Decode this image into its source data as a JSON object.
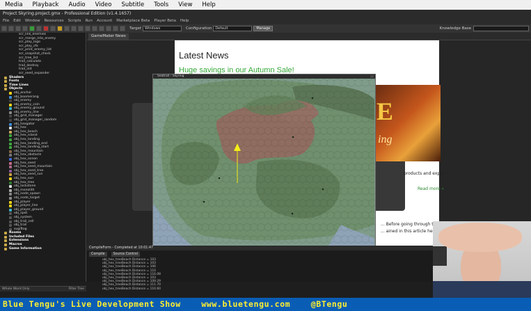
{
  "os_menu": [
    "Media",
    "Playback",
    "Audio",
    "Video",
    "Subtitle",
    "Tools",
    "View",
    "Help"
  ],
  "gm_title": "Project Skyring.project.gmx - Professional Edition (v1.4.1657)",
  "gm_menu": [
    "File",
    "Edit",
    "Window",
    "Resources",
    "Scripts",
    "Run",
    "Account",
    "Marketplace Beta",
    "Player Beta",
    "Help"
  ],
  "toolbar": {
    "target_label": "Target",
    "target_value": "Windows",
    "config_label": "Configuration",
    "config_value": "Default",
    "manage": "Manage",
    "knowledge": "Knowledge Base"
  },
  "tree": [
    {
      "t": "scr_link_enemies",
      "d": 3
    },
    {
      "t": "scr_merge_into_enemy",
      "d": 3
    },
    {
      "t": "scr_play_logo",
      "d": 3
    },
    {
      "t": "scr_play_sfx",
      "d": 3
    },
    {
      "t": "scr_print_enemy_list",
      "d": 3
    },
    {
      "t": "scr_snapshot_check",
      "d": 3
    },
    {
      "t": "scr_tree_list",
      "d": 3
    },
    {
      "t": "trail_calculate",
      "d": 3
    },
    {
      "t": "trail_destroy",
      "d": 3
    },
    {
      "t": "trail_init",
      "d": 3
    },
    {
      "t": "scr_seed_expander",
      "d": 3
    },
    {
      "t": "Shaders",
      "d": 1,
      "g": true
    },
    {
      "t": "Fonts",
      "d": 1,
      "g": true
    },
    {
      "t": "Time Lines",
      "d": 1,
      "g": true
    },
    {
      "t": "Objects",
      "d": 1,
      "g": true
    },
    {
      "t": "obj_anchor",
      "d": 2,
      "c": "#f2d21a"
    },
    {
      "t": "obj_boomerang",
      "d": 2,
      "c": "#3a8ad8"
    },
    {
      "t": "obj_enemy",
      "d": 2,
      "c": "#444"
    },
    {
      "t": "obj_enemy_coin",
      "d": 2,
      "c": "#f2d21a"
    },
    {
      "t": "obj_enemy_ground",
      "d": 2,
      "c": "#3ab0c8"
    },
    {
      "t": "obj_enemy_line",
      "d": 2,
      "c": "#888"
    },
    {
      "t": "obj_grid_manager",
      "d": 2,
      "c": "#444"
    },
    {
      "t": "obj_grid_manager_random",
      "d": 2,
      "c": "#444"
    },
    {
      "t": "obj_hexgator",
      "d": 2,
      "c": "#3a8ad8"
    },
    {
      "t": "obj_hex",
      "d": 2,
      "c": "#ddd"
    },
    {
      "t": "obj_hex_beach",
      "d": 2,
      "c": "#caa860"
    },
    {
      "t": "obj_hex_island",
      "d": 2,
      "c": "#3ea63e"
    },
    {
      "t": "obj_hex_landing",
      "d": 2,
      "c": "#3ea63e"
    },
    {
      "t": "obj_hex_landing_end",
      "d": 2,
      "c": "#3ea63e"
    },
    {
      "t": "obj_hex_landing_start",
      "d": 2,
      "c": "#3ea63e"
    },
    {
      "t": "obj_hex_mountain",
      "d": 2,
      "c": "#8a6a4a"
    },
    {
      "t": "obj_hex_obstacle",
      "d": 2,
      "c": "#777"
    },
    {
      "t": "obj_hex_ocean",
      "d": 2,
      "c": "#3a6ad8"
    },
    {
      "t": "obj_hex_seed",
      "d": 2,
      "c": "#c86a8a"
    },
    {
      "t": "obj_hex_seed_mountain",
      "d": 2,
      "c": "#a86a8a"
    },
    {
      "t": "obj_hex_seed_tree",
      "d": 2,
      "c": "#8a5a9a"
    },
    {
      "t": "obj_hex_seed_sun",
      "d": 2,
      "c": "#c8a040"
    },
    {
      "t": "obj_hex_sun",
      "d": 2,
      "c": "#f2d21a"
    },
    {
      "t": "obj_hex_tree",
      "d": 2,
      "c": "#2e7a2e"
    },
    {
      "t": "obj_lockstone",
      "d": 2,
      "c": "#ddd"
    },
    {
      "t": "obj_monolith",
      "d": 2,
      "c": "#aaa"
    },
    {
      "t": "obj_node_spawn",
      "d": 2,
      "c": "#888"
    },
    {
      "t": "obj_node_target",
      "d": 2,
      "c": "#888"
    },
    {
      "t": "obj_player",
      "d": 2,
      "c": "#f2d21a"
    },
    {
      "t": "obj_player_line",
      "d": 2,
      "c": "#f2d21a"
    },
    {
      "t": "obj_player_ground",
      "d": 2,
      "c": "#3ab0c8"
    },
    {
      "t": "obj_spot",
      "d": 2,
      "c": "#555"
    },
    {
      "t": "obj_system",
      "d": 2,
      "c": "#555"
    },
    {
      "t": "obj_trail_cell",
      "d": 2,
      "c": "#555"
    },
    {
      "t": "obj_trail",
      "d": 2,
      "c": "#555"
    },
    {
      "t": "sugiftog",
      "d": 2,
      "c": "#555"
    },
    {
      "t": "Rooms",
      "d": 1,
      "g": true
    },
    {
      "t": "Included Files",
      "d": 1,
      "g": true
    },
    {
      "t": "Extensions",
      "d": 1,
      "g": true
    },
    {
      "t": "Macros",
      "d": 1,
      "g": true
    },
    {
      "t": "Game Information",
      "d": 1,
      "g": true
    }
  ],
  "tree_filter": {
    "left": "Whole Word Only",
    "right": "Filter Tree"
  },
  "news_tab": "GameMaker News",
  "news": {
    "title": "Latest News",
    "headline": "Huge savings in our Autumn Sale!",
    "banner_big": "E",
    "banner_small": "ing",
    "products": "products and export",
    "more": "Read more »",
    "body1": "... Before going through this, you will",
    "body2": "... ained in this article here:"
  },
  "game_window": {
    "title": "Seatrail - Skyring"
  },
  "compile": {
    "header": "CompileForm - Completed at 10:01:47",
    "tabs": [
      "Compile",
      "Source Control"
    ],
    "log": [
      "obj_hex_treeBeach Distance = 103",
      "obj_hex_treeBeach Distance = 103",
      "obj_hex_treeBeach Distance = 106",
      "obj_hex_treeBeach Distance = 110",
      "obj_hex_treeBeach Distance = 116.08",
      "obj_hex_treeBeach Distance = 103",
      "obj_hex_treeBeach Distance = 109.29",
      "obj_hex_treeBeach Distance = 111.70",
      "obj_hex_treeBeach Distance = 110.60"
    ]
  },
  "banner": [
    "Blue Tengu's Live Development Show",
    "www.bluetengu.com",
    "@BTengu"
  ],
  "colors": {
    "banner_bg": "#0a5db5",
    "banner_text": "#ffef30",
    "news_green": "#35a838",
    "player_arrow": "#f5ee18"
  }
}
